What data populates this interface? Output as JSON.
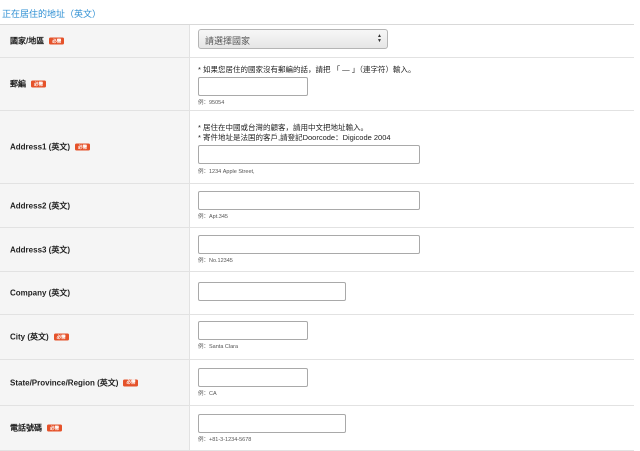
{
  "section_title": "正在居住的地址（英文）",
  "required_badge": "必需",
  "country": {
    "label": "國家/地區",
    "select_value": "請選擇國家"
  },
  "postal": {
    "label": "郵編",
    "note": "* 如果您居住的國家沒有郵編的話，請把 「 — 」（連字符）輸入。",
    "hint": "例：95054"
  },
  "address1": {
    "label": "Address1 (英文)",
    "note1": "* 居住在中國或台灣的顧客，請用中文把地址輸入。",
    "note2": "* 寄件地址是法国的客戶,請登記Doorcode：Digicode 2004",
    "hint": "例：1234 Apple Street,"
  },
  "address2": {
    "label": "Address2 (英文)",
    "hint": "例：Apt.345"
  },
  "address3": {
    "label": "Address3 (英文)",
    "hint": "例：No.12345"
  },
  "company": {
    "label": "Company (英文)"
  },
  "city": {
    "label": "City (英文)",
    "hint": "例：Santa Clara"
  },
  "state": {
    "label": "State/Province/Region (英文)",
    "hint": "例：CA"
  },
  "phone": {
    "label": "電話號碼",
    "hint": "例：+81-3-1234-5678"
  },
  "select_icon": "up-down-arrows-icon"
}
